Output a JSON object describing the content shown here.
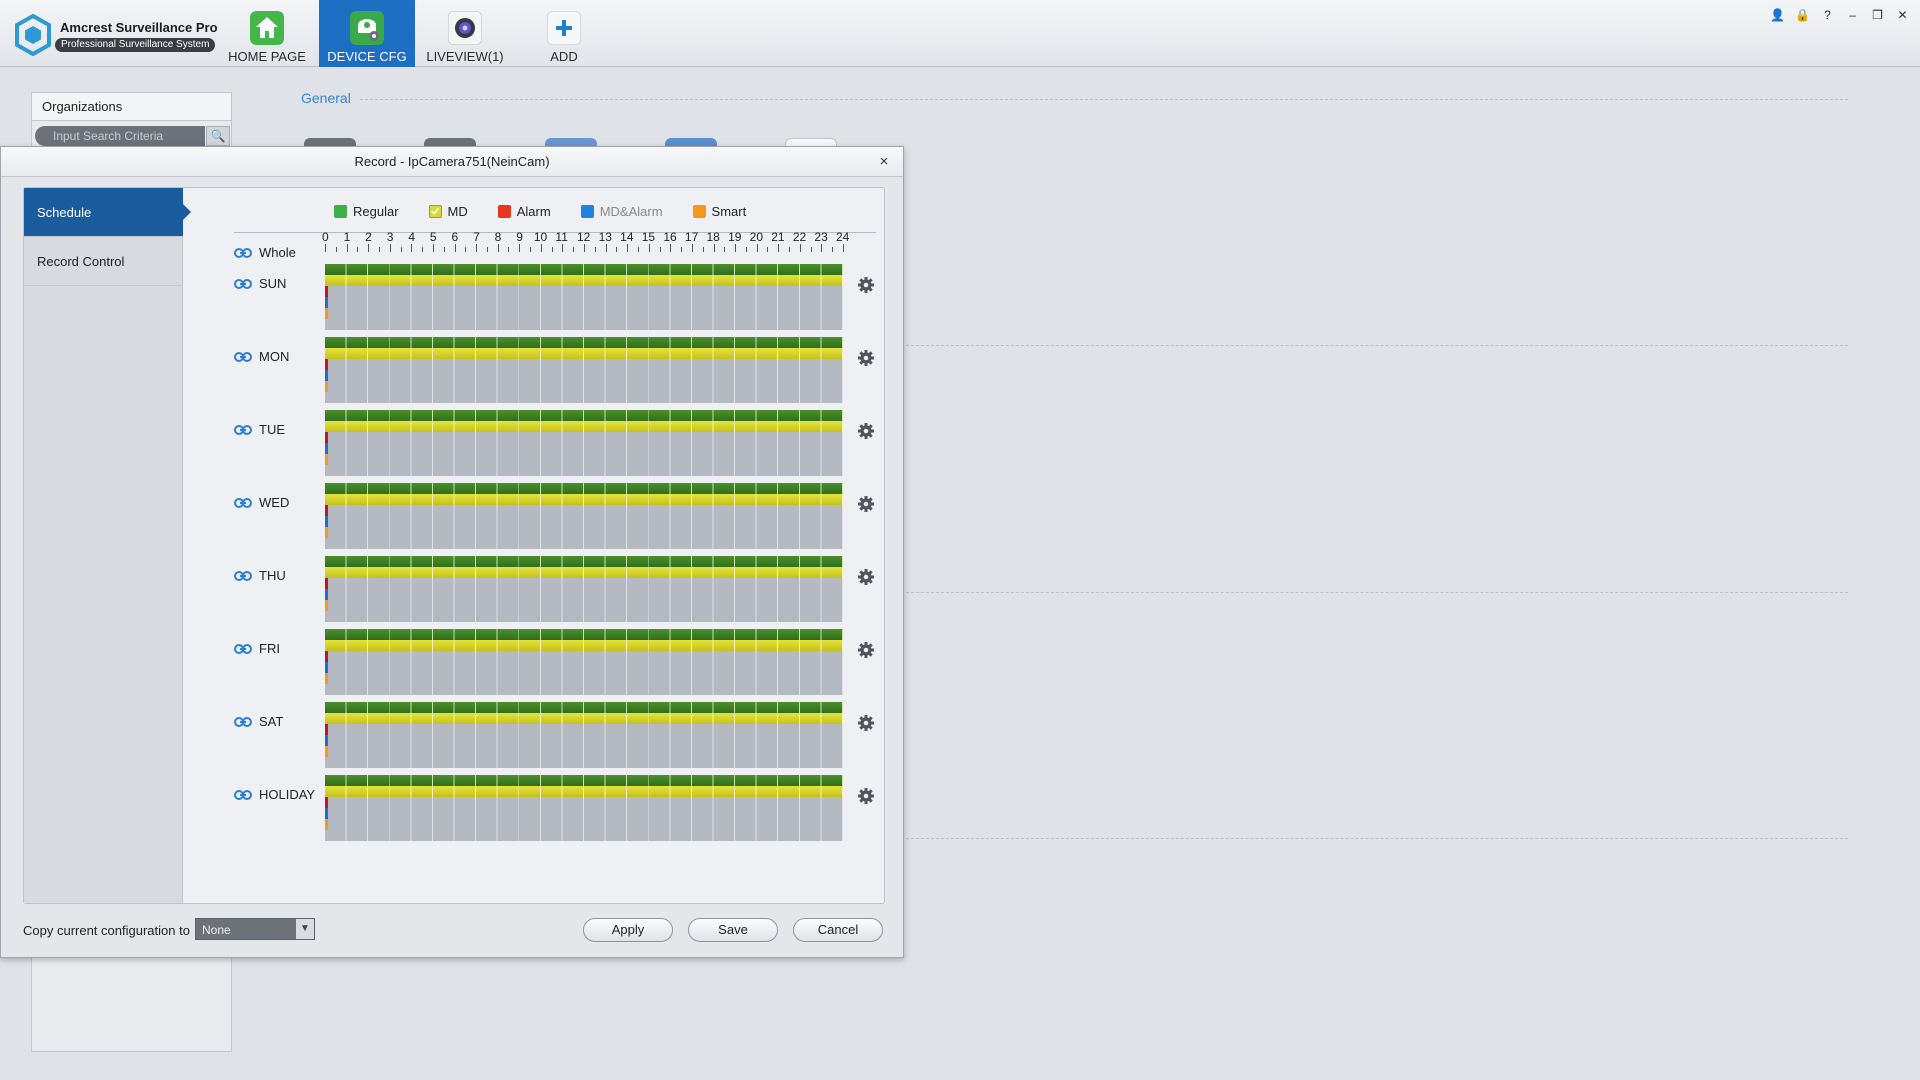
{
  "app": {
    "title": "Amcrest Surveillance Pro",
    "subtitle": "Professional Surveillance System"
  },
  "nav": [
    {
      "label": "HOME PAGE",
      "icon": "home-icon",
      "active": false
    },
    {
      "label": "DEVICE CFG",
      "icon": "device-cfg-icon",
      "active": true
    },
    {
      "label": "LIVEVIEW(1)",
      "icon": "camera-icon",
      "active": false
    },
    {
      "label": "ADD",
      "icon": "plus-icon",
      "active": false
    }
  ],
  "window_controls": [
    {
      "name": "user-icon",
      "glyph": "👤"
    },
    {
      "name": "lock-icon",
      "glyph": "🔒"
    },
    {
      "name": "help-icon",
      "glyph": "?"
    },
    {
      "name": "minimize-icon",
      "glyph": "–"
    },
    {
      "name": "restore-icon",
      "glyph": "❐"
    },
    {
      "name": "close-icon",
      "glyph": "✕"
    }
  ],
  "background": {
    "organizations_title": "Organizations",
    "search_placeholder": "Input Search Criteria",
    "general_heading": "General"
  },
  "dialog": {
    "title": "Record - IpCamera751(NeinCam)",
    "close_glyph": "×",
    "sidebar": [
      {
        "label": "Schedule",
        "active": true
      },
      {
        "label": "Record Control",
        "active": false
      }
    ],
    "legend": [
      {
        "label": "Regular",
        "color": "#3cb043",
        "muted": false
      },
      {
        "label": "MD",
        "color": "#d8d93a",
        "muted": false
      },
      {
        "label": "Alarm",
        "color": "#e8361e",
        "muted": false
      },
      {
        "label": "MD&Alarm",
        "color": "#1e82e0",
        "muted": true
      },
      {
        "label": "Smart",
        "color": "#f5981d",
        "muted": false
      }
    ],
    "whole_label": "Whole",
    "hours": [
      "0",
      "1",
      "2",
      "3",
      "4",
      "5",
      "6",
      "7",
      "8",
      "9",
      "10",
      "11",
      "12",
      "13",
      "14",
      "15",
      "16",
      "17",
      "18",
      "19",
      "20",
      "21",
      "22",
      "23",
      "24"
    ],
    "days": [
      {
        "label": "SUN",
        "regular": [
          0,
          24
        ],
        "md": [
          0,
          24
        ],
        "alarm": [],
        "md_alarm": [],
        "smart": []
      },
      {
        "label": "MON",
        "regular": [
          0,
          24
        ],
        "md": [
          0,
          24
        ],
        "alarm": [],
        "md_alarm": [],
        "smart": []
      },
      {
        "label": "TUE",
        "regular": [
          0,
          24
        ],
        "md": [
          0,
          24
        ],
        "alarm": [],
        "md_alarm": [],
        "smart": []
      },
      {
        "label": "WED",
        "regular": [
          0,
          24
        ],
        "md": [
          0,
          24
        ],
        "alarm": [],
        "md_alarm": [],
        "smart": []
      },
      {
        "label": "THU",
        "regular": [
          0,
          24
        ],
        "md": [
          0,
          24
        ],
        "alarm": [],
        "md_alarm": [],
        "smart": []
      },
      {
        "label": "FRI",
        "regular": [
          0,
          24
        ],
        "md": [
          0,
          24
        ],
        "alarm": [],
        "md_alarm": [],
        "smart": []
      },
      {
        "label": "SAT",
        "regular": [
          0,
          24
        ],
        "md": [
          0,
          24
        ],
        "alarm": [],
        "md_alarm": [],
        "smart": []
      },
      {
        "label": "HOLIDAY",
        "regular": [
          0,
          24
        ],
        "md": [
          0,
          24
        ],
        "alarm": [],
        "md_alarm": [],
        "smart": []
      }
    ],
    "copy_label": "Copy current configuration to",
    "copy_value": "None",
    "buttons": {
      "apply": "Apply",
      "save": "Save",
      "cancel": "Cancel"
    }
  }
}
